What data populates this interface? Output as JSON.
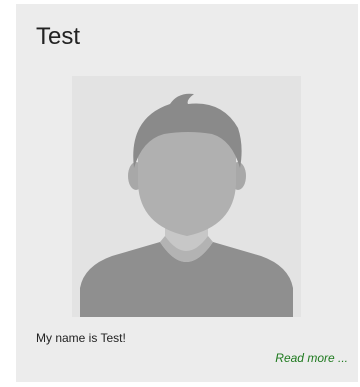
{
  "card": {
    "title": "Test",
    "avatar_icon": "person-silhouette-icon",
    "bio": "My name is Test!",
    "read_more_label": "Read more ..."
  },
  "colors": {
    "card_background": "#ececec",
    "avatar_background": "#e3e3e3",
    "link": "#1f7a1f",
    "silhouette": "#9e9e9e"
  }
}
